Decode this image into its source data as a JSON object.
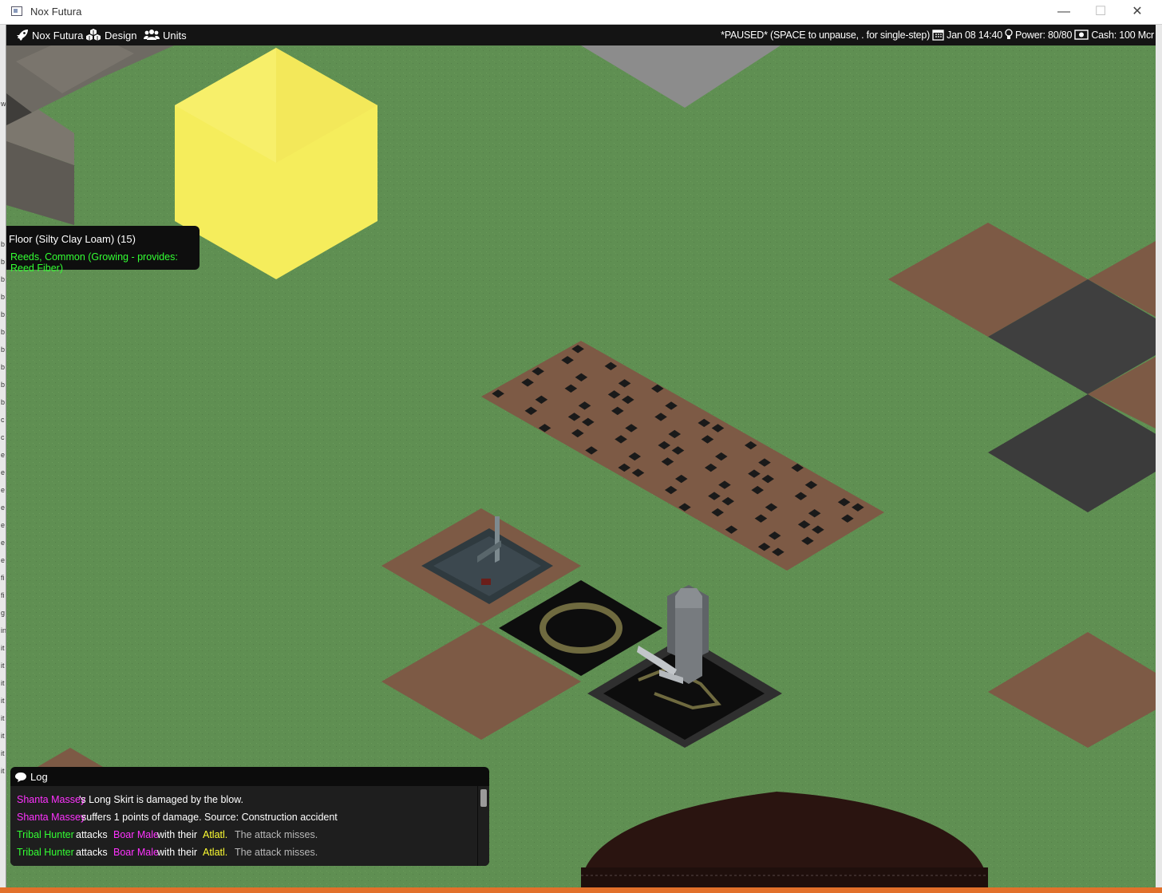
{
  "window": {
    "title": "Nox Futura",
    "minimize": "—",
    "maximize": "☐",
    "close": "✕"
  },
  "menu": [
    {
      "label": "Nox Futura",
      "icon": "rocket-icon"
    },
    {
      "label": "Design",
      "icon": "cubes-icon"
    },
    {
      "label": "Units",
      "icon": "users-icon"
    }
  ],
  "status": {
    "paused": "*PAUSED* (SPACE to unpause, . for single-step)",
    "date": "Jan 08 14:40",
    "power": "Power: 80/80",
    "cash": "Cash: 100 Mcr"
  },
  "tooltip": {
    "line1": "Floor (Silty Clay Loam) (15)",
    "line2": "Reeds, Common (Growing - provides: Reed Fiber)"
  },
  "log": {
    "title": "Log",
    "entries": [
      {
        "a": "Shanta Massey",
        "b": "'s Long Skirt is damaged by the blow."
      },
      {
        "a": "Shanta Massey",
        "b": "suffers 1 points of damage. Source: Construction accident"
      },
      {
        "a": "Tribal Hunter",
        "b": "attacks",
        "c": "Boar Male",
        "d": "with their",
        "e": "Atlatl.",
        "f": "The attack misses."
      },
      {
        "a": "Tribal Hunter",
        "b": "attacks",
        "c": "Boar Male",
        "d": "with their",
        "e": "Atlatl.",
        "f": "The attack misses."
      }
    ]
  },
  "colors": {
    "grass": "#5f8f52",
    "soil": "#7d5a45",
    "selection": "#f5ed5c",
    "log_name": "#ff33ff",
    "log_actor": "#33ff33",
    "log_item": "#ffff33"
  }
}
